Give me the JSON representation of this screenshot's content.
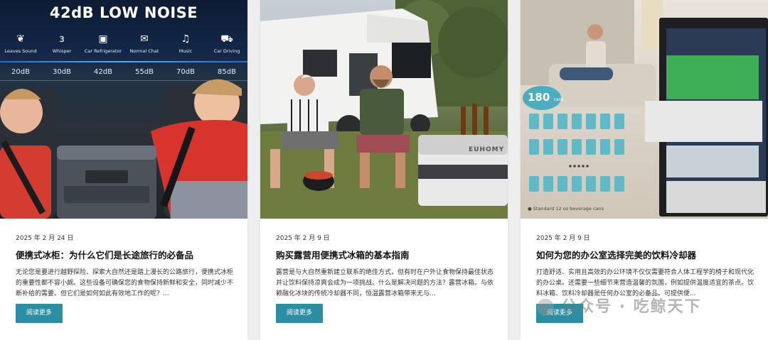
{
  "cards": [
    {
      "image": {
        "headline": "42dB LOW NOISE",
        "levels": [
          {
            "icon": "leaves-icon",
            "label": "Leaves Sound",
            "db": "20dB"
          },
          {
            "icon": "ear-icon",
            "label": "Whisper",
            "db": "30dB"
          },
          {
            "icon": "car-refrigerator-icon",
            "label": "Car Refrigerator",
            "db": "42dB"
          },
          {
            "icon": "chat-icon",
            "label": "Normal Chat",
            "db": "55dB"
          },
          {
            "icon": "music-icon",
            "label": "Music",
            "db": "70dB"
          },
          {
            "icon": "car-icon",
            "label": "Car Driving",
            "db": "85dB"
          }
        ]
      },
      "date": "2025 年 2 月 24 日",
      "title": "便携式冰柜：为什么它们是长途旅行的必备品",
      "excerpt": "无论您是要进行越野探险、探索大自然还是踏上漫长的公路旅行，便携式冰柜的重要性都不容小觑。这些设备可确保您的食物保持新鲜和安全，同时减少不断补给的需要。但它们是如何如此有效地工作的呢？...",
      "button": "阅读更多"
    },
    {
      "image": {
        "brand": "EUHOMY"
      },
      "date": "2025 年 2 月 9 日",
      "title": "购买露营用便携式冰箱的基本指南",
      "excerpt": "露营是与大自然重新建立联系的绝佳方式，但有时在户外让食物保持最佳状态并让饮料保持凉爽会成为一项挑战。什么是解决问题的方法？露营冰箱。与依赖融化冰块的传统冷却器不同，恒温露营冰箱带来无与...",
      "button": "阅读更多"
    },
    {
      "image": {
        "badge_number": "180",
        "badge_unit": "cans",
        "caption": "Standard 12 oz beverage cans"
      },
      "date": "2025 年 2 月 9 日",
      "title": "如何为您的办公室选择完美的饮料冷却器",
      "excerpt": "打造舒适、实用且高效的办公环境不仅仅需要符合人体工程学的椅子和现代化的办公桌。还需要一些细节来营造温馨的氛围，例如提供温度适宜的茶点。饮料冰箱、饮料冷却器是任何办公室的必备品。可提供便...",
      "button": "阅读更多"
    }
  ],
  "watermark": "公众号 · 吃鲸天下"
}
